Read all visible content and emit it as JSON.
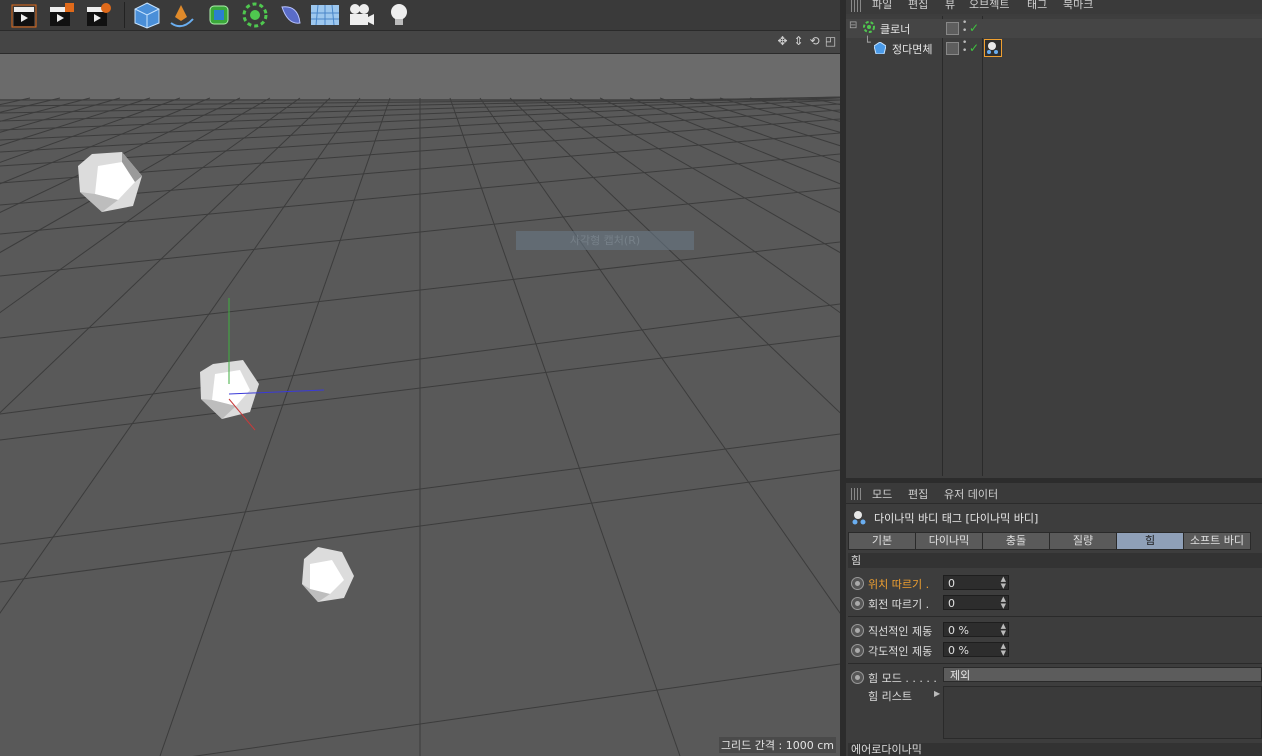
{
  "toolbar": {
    "icons": [
      "render-view-icon",
      "render-picture-viewer-icon",
      "edit-render-settings-icon",
      "cube-icon",
      "pen-spline-icon",
      "subdivision-surface-icon",
      "array-cloner-icon",
      "deformer-icon",
      "floor-environment-icon",
      "camera-icon",
      "light-icon"
    ]
  },
  "viewport": {
    "grid_spacing": "그리드 간격 : 1000 cm",
    "marquee_label": "사각형 캡처(R)"
  },
  "object_manager": {
    "menu": [
      "파일",
      "편집",
      "뷰",
      "오브젝트",
      "태그",
      "북마크"
    ],
    "objects": [
      {
        "name": "클로너",
        "icon": "cloner-icon",
        "check": "✓"
      },
      {
        "name": "정다면체",
        "icon": "platonic-icon",
        "check": "✓",
        "tag": "dynamics-body-tag-icon"
      }
    ]
  },
  "attribute_manager": {
    "menu": [
      "모드",
      "편집",
      "유저 데이터"
    ],
    "title": "다이나믹 바디 태그 [다이나믹 바디]",
    "tabs": [
      "기본",
      "다이나믹",
      "충돌",
      "질량",
      "힘",
      "소프트 바디"
    ],
    "active_tab": "힘",
    "section": "힘",
    "params": [
      {
        "label": "위치 따르기 .",
        "value": "0",
        "highlight": true
      },
      {
        "label": "회전 따르기 .",
        "value": "0",
        "highlight": false
      },
      {
        "label": "직선적인 제동",
        "value": "0 %",
        "highlight": false
      },
      {
        "label": "각도적인 제동",
        "value": "0 %",
        "highlight": false
      }
    ],
    "force_mode_label": "힘 모드 . . . . .",
    "force_mode_value": "제외",
    "force_list_label": "힘 리스트",
    "footer_section": "에어로다이나믹"
  },
  "colors": {
    "accent_tab": "#8fa0b8",
    "check": "#3fc43f",
    "highlight": "#f0a030"
  }
}
